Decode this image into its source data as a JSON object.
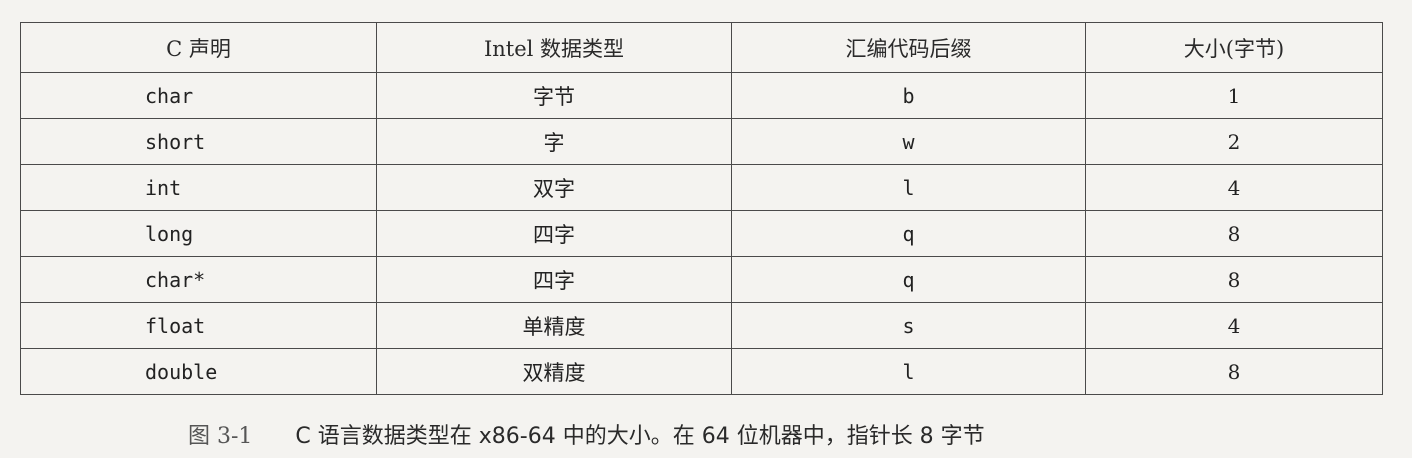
{
  "table": {
    "headers": [
      "C 声明",
      "Intel 数据类型",
      "汇编代码后缀",
      "大小(字节)"
    ],
    "rows": [
      {
        "c_decl": "char",
        "intel_type": "字节",
        "suffix": "b",
        "size": "1"
      },
      {
        "c_decl": "short",
        "intel_type": "字",
        "suffix": "w",
        "size": "2"
      },
      {
        "c_decl": "int",
        "intel_type": "双字",
        "suffix": "l",
        "size": "4"
      },
      {
        "c_decl": "long",
        "intel_type": "四字",
        "suffix": "q",
        "size": "8"
      },
      {
        "c_decl": "char*",
        "intel_type": "四字",
        "suffix": "q",
        "size": "8"
      },
      {
        "c_decl": "float",
        "intel_type": "单精度",
        "suffix": "s",
        "size": "4"
      },
      {
        "c_decl": "double",
        "intel_type": "双精度",
        "suffix": "l",
        "size": "8"
      }
    ]
  },
  "caption": {
    "label": "图 3-1",
    "text": "C 语言数据类型在 x86-64 中的大小。在 64 位机器中，指针长 8 字节"
  }
}
